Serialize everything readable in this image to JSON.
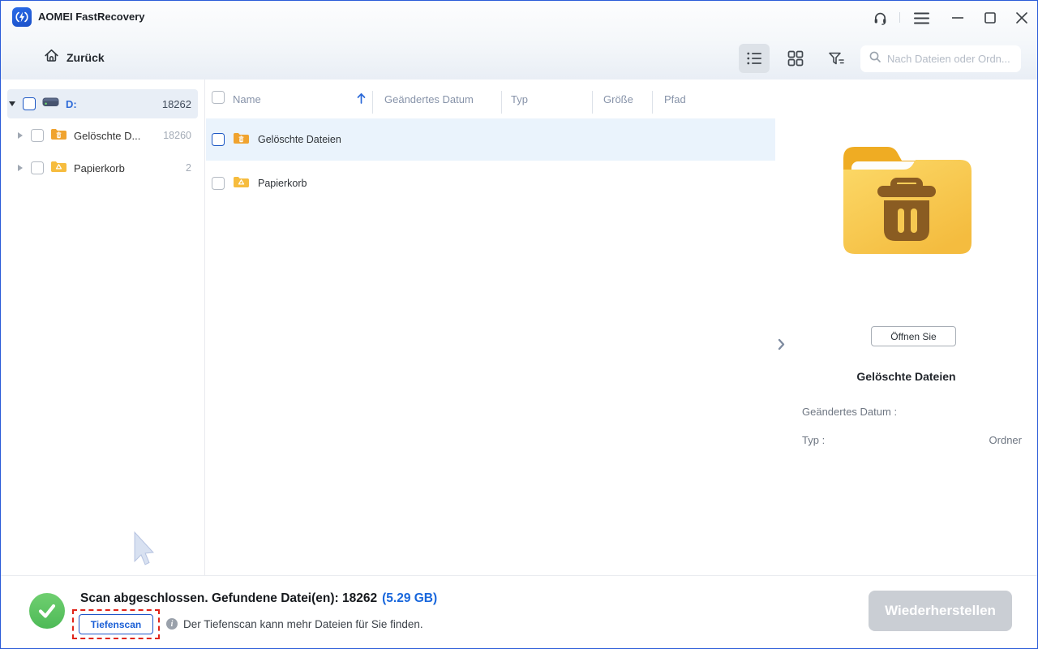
{
  "titlebar": {
    "app_title": "AOMEI FastRecovery"
  },
  "toolbar": {
    "back_label": "Zurück",
    "search_placeholder": "Nach Dateien oder Ordn..."
  },
  "sidebar": {
    "items": [
      {
        "label": "D:",
        "count": "18262"
      },
      {
        "label": "Gelöschte D...",
        "count": "18260"
      },
      {
        "label": "Papierkorb",
        "count": "2"
      }
    ]
  },
  "filelist": {
    "columns": [
      "Name",
      "Geändertes Datum",
      "Typ",
      "Größe",
      "Pfad"
    ],
    "rows": [
      {
        "name": "Gelöschte Dateien"
      },
      {
        "name": "Papierkorb"
      }
    ]
  },
  "details": {
    "open_button_label": "Öffnen Sie",
    "item_title": "Gelöschte Dateien",
    "modified_label": "Geändertes Datum :",
    "modified_value": "",
    "type_label": "Typ :",
    "type_value": "Ordner"
  },
  "statusbar": {
    "scan_summary": "Scan abgeschlossen. Gefundene Datei(en): 18262",
    "scan_size": "(5.29 GB)",
    "deep_scan_label": "Tiefenscan",
    "info_glyph": "i",
    "deep_scan_hint": "Der Tiefenscan kann mehr Dateien für Sie finden.",
    "restore_label": "Wiederherstellen"
  },
  "colors": {
    "accent_blue": "#2162d3",
    "selected_row_blue": "#eaf3fc",
    "sidebar_selected": "#e8eef6",
    "success_green": "#4eba57",
    "annotation_red": "#e0251b",
    "folder_yellow": "#f6c244",
    "disabled_gray": "#caced4"
  }
}
